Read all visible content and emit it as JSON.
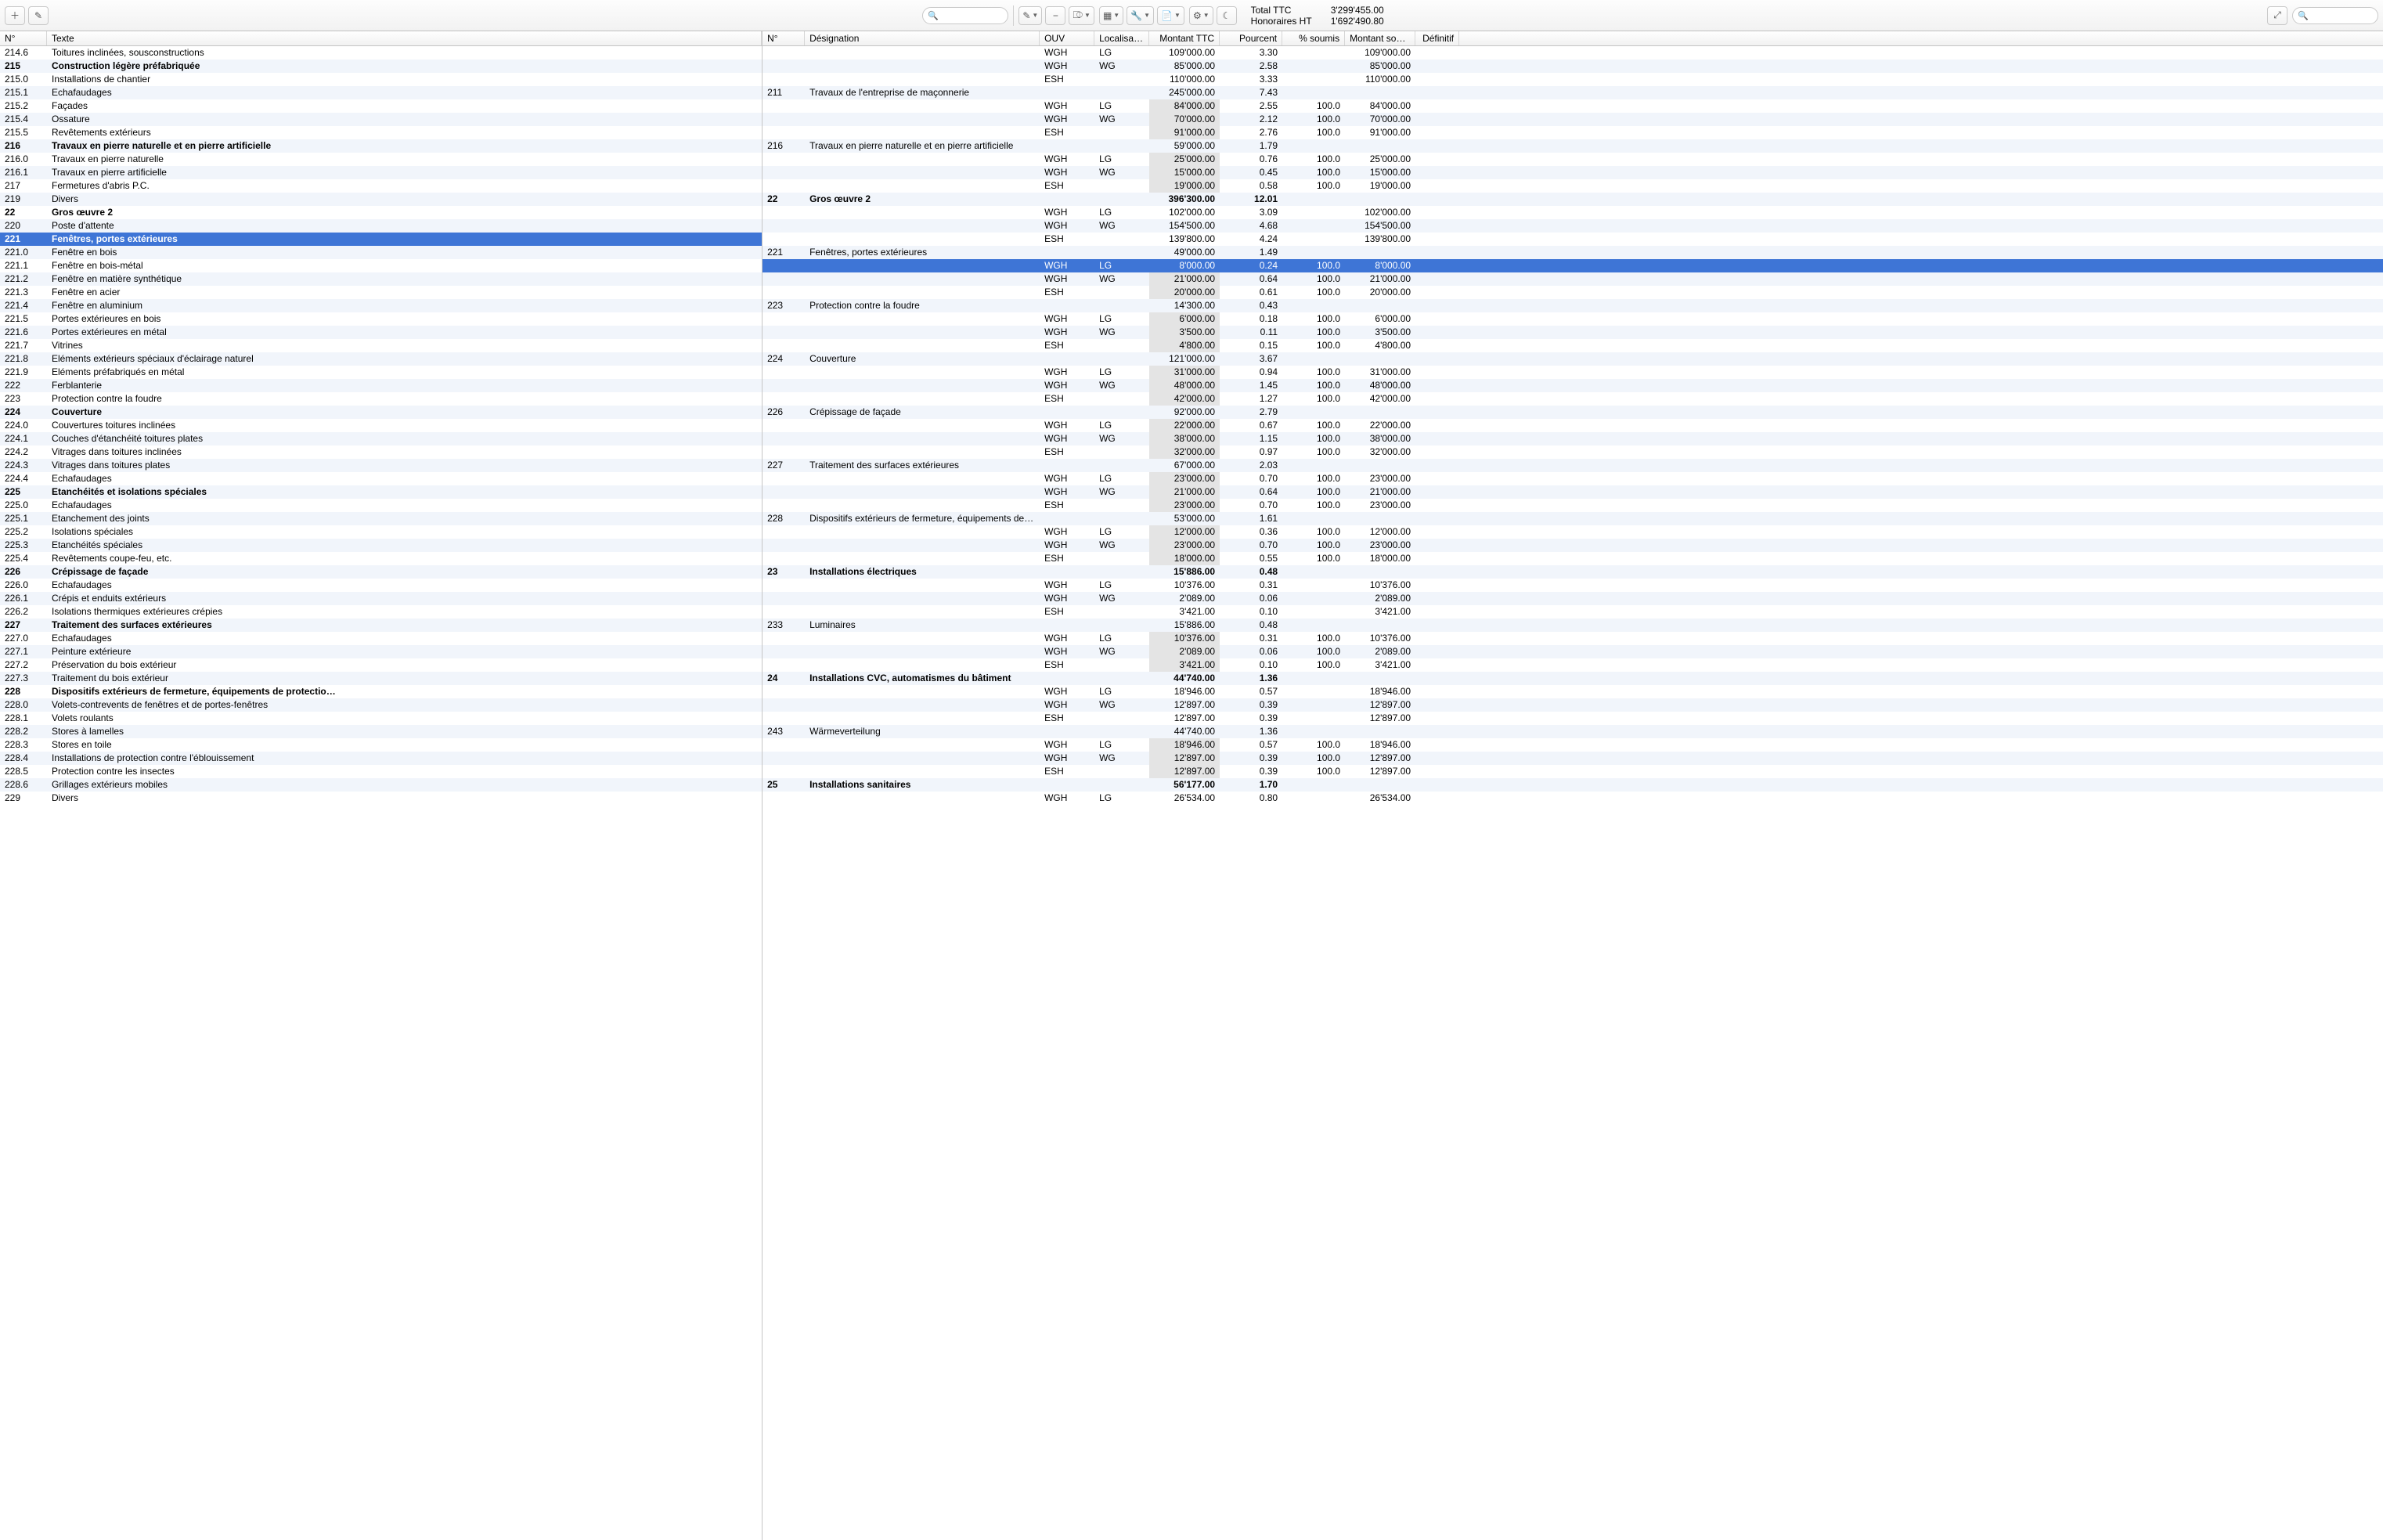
{
  "toolbar": {
    "add_icon": "＋",
    "edit_icon": "✎",
    "search_placeholder": "",
    "pencil_dd": "✎",
    "minus": "−",
    "filter": "⎄",
    "table": "▦",
    "wrench": "🔧",
    "doc": "📄",
    "gear": "⚙",
    "moon": "☾",
    "expand": "⤢"
  },
  "summary": {
    "total_label": "Total TTC",
    "total_value": "3'299'455.00",
    "fees_label": "Honoraires HT",
    "fees_value": "1'692'490.80"
  },
  "left": {
    "headers": {
      "no": "N°",
      "text": "Texte"
    },
    "selected_no": "221",
    "rows": [
      {
        "no": "214.6",
        "text": "Toitures inclinées, sousconstructions"
      },
      {
        "no": "215",
        "text": "Construction légère préfabriquée",
        "bold": true
      },
      {
        "no": "215.0",
        "text": "Installations de chantier"
      },
      {
        "no": "215.1",
        "text": "Echafaudages"
      },
      {
        "no": "215.2",
        "text": "Façades"
      },
      {
        "no": "215.4",
        "text": "Ossature"
      },
      {
        "no": "215.5",
        "text": "Revêtements extérieurs"
      },
      {
        "no": "216",
        "text": "Travaux en pierre naturelle et en pierre artificielle",
        "bold": true
      },
      {
        "no": "216.0",
        "text": "Travaux en pierre naturelle"
      },
      {
        "no": "216.1",
        "text": "Travaux en pierre artificielle"
      },
      {
        "no": "217",
        "text": "Fermetures d'abris P.C."
      },
      {
        "no": "219",
        "text": "Divers"
      },
      {
        "no": "22",
        "text": "Gros œuvre 2",
        "bold": true
      },
      {
        "no": "220",
        "text": "Poste d'attente"
      },
      {
        "no": "221",
        "text": "Fenêtres, portes extérieures",
        "bold": true
      },
      {
        "no": "221.0",
        "text": "Fenêtre en bois"
      },
      {
        "no": "221.1",
        "text": "Fenêtre en bois-métal"
      },
      {
        "no": "221.2",
        "text": "Fenêtre en matière synthétique"
      },
      {
        "no": "221.3",
        "text": "Fenêtre en acier"
      },
      {
        "no": "221.4",
        "text": "Fenêtre en aluminium"
      },
      {
        "no": "221.5",
        "text": "Portes extérieures en bois"
      },
      {
        "no": "221.6",
        "text": "Portes extérieures en métal"
      },
      {
        "no": "221.7",
        "text": "Vitrines"
      },
      {
        "no": "221.8",
        "text": "Eléments extérieurs spéciaux d'éclairage naturel"
      },
      {
        "no": "221.9",
        "text": "Eléments préfabriqués en métal"
      },
      {
        "no": "222",
        "text": "Ferblanterie"
      },
      {
        "no": "223",
        "text": "Protection contre la foudre"
      },
      {
        "no": "224",
        "text": "Couverture",
        "bold": true
      },
      {
        "no": "224.0",
        "text": "Couvertures toitures inclinées"
      },
      {
        "no": "224.1",
        "text": "Couches d'étanchéité toitures plates"
      },
      {
        "no": "224.2",
        "text": "Vitrages dans toitures inclinées"
      },
      {
        "no": "224.3",
        "text": "Vitrages dans toitures plates"
      },
      {
        "no": "224.4",
        "text": "Echafaudages"
      },
      {
        "no": "225",
        "text": "Etanchéités et isolations spéciales",
        "bold": true
      },
      {
        "no": "225.0",
        "text": "Echafaudages"
      },
      {
        "no": "225.1",
        "text": "Etanchement des joints"
      },
      {
        "no": "225.2",
        "text": "Isolations spéciales"
      },
      {
        "no": "225.3",
        "text": "Etanchéités spéciales"
      },
      {
        "no": "225.4",
        "text": "Revêtements coupe-feu, etc."
      },
      {
        "no": "226",
        "text": "Crépissage de façade",
        "bold": true
      },
      {
        "no": "226.0",
        "text": "Echafaudages"
      },
      {
        "no": "226.1",
        "text": "Crépis et enduits extérieurs"
      },
      {
        "no": "226.2",
        "text": "Isolations thermiques extérieures crépies"
      },
      {
        "no": "227",
        "text": "Traitement des surfaces extérieures",
        "bold": true
      },
      {
        "no": "227.0",
        "text": "Echafaudages"
      },
      {
        "no": "227.1",
        "text": "Peinture extérieure"
      },
      {
        "no": "227.2",
        "text": "Préservation du bois extérieur"
      },
      {
        "no": "227.3",
        "text": "Traitement du bois extérieur"
      },
      {
        "no": "228",
        "text": "Dispositifs extérieurs de fermeture, équipements de protectio…",
        "bold": true
      },
      {
        "no": "228.0",
        "text": "Volets-contrevents de fenêtres et de portes-fenêtres"
      },
      {
        "no": "228.1",
        "text": "Volets roulants"
      },
      {
        "no": "228.2",
        "text": "Stores à lamelles"
      },
      {
        "no": "228.3",
        "text": "Stores en toile"
      },
      {
        "no": "228.4",
        "text": "Installations de protection contre l'éblouissement"
      },
      {
        "no": "228.5",
        "text": "Protection contre les insectes"
      },
      {
        "no": "228.6",
        "text": "Grillages extérieurs mobiles"
      },
      {
        "no": "229",
        "text": "Divers"
      }
    ]
  },
  "right": {
    "headers": {
      "no": "N°",
      "desig": "Désignation",
      "ouv": "OUV",
      "loc": "Localisation",
      "ttc": "Montant TTC",
      "pct": "Pourcent",
      "sou": "% soumis",
      "msou": "Montant sou…",
      "def": "Définitif"
    },
    "selected_index": 15,
    "rows": [
      {
        "no": "",
        "desig": "",
        "ouv": "WGH",
        "loc": "LG",
        "ttc": "109'000.00",
        "pct": "3.30",
        "sou": "",
        "msou": "109'000.00",
        "def": ""
      },
      {
        "no": "",
        "desig": "",
        "ouv": "WGH",
        "loc": "WG",
        "ttc": "85'000.00",
        "pct": "2.58",
        "sou": "",
        "msou": "85'000.00",
        "def": ""
      },
      {
        "no": "",
        "desig": "",
        "ouv": "ESH",
        "loc": "",
        "ttc": "110'000.00",
        "pct": "3.33",
        "sou": "",
        "msou": "110'000.00",
        "def": ""
      },
      {
        "no": "211",
        "desig": "Travaux de l'entreprise de maçonnerie",
        "ttc": "245'000.00",
        "pct": "7.43"
      },
      {
        "no": "",
        "desig": "",
        "ouv": "WGH",
        "loc": "LG",
        "ttc": "84'000.00",
        "pct": "2.55",
        "sou": "100.0",
        "msou": "84'000.00",
        "shade": true
      },
      {
        "no": "",
        "desig": "",
        "ouv": "WGH",
        "loc": "WG",
        "ttc": "70'000.00",
        "pct": "2.12",
        "sou": "100.0",
        "msou": "70'000.00",
        "shade": true
      },
      {
        "no": "",
        "desig": "",
        "ouv": "ESH",
        "loc": "",
        "ttc": "91'000.00",
        "pct": "2.76",
        "sou": "100.0",
        "msou": "91'000.00",
        "shade": true
      },
      {
        "no": "216",
        "desig": "Travaux en pierre naturelle et en pierre artificielle",
        "ttc": "59'000.00",
        "pct": "1.79"
      },
      {
        "no": "",
        "desig": "",
        "ouv": "WGH",
        "loc": "LG",
        "ttc": "25'000.00",
        "pct": "0.76",
        "sou": "100.0",
        "msou": "25'000.00",
        "shade": true
      },
      {
        "no": "",
        "desig": "",
        "ouv": "WGH",
        "loc": "WG",
        "ttc": "15'000.00",
        "pct": "0.45",
        "sou": "100.0",
        "msou": "15'000.00",
        "shade": true
      },
      {
        "no": "",
        "desig": "",
        "ouv": "ESH",
        "loc": "",
        "ttc": "19'000.00",
        "pct": "0.58",
        "sou": "100.0",
        "msou": "19'000.00",
        "shade": true
      },
      {
        "no": "22",
        "desig": "Gros œuvre 2",
        "ttc": "396'300.00",
        "pct": "12.01",
        "bold": true
      },
      {
        "no": "",
        "desig": "",
        "ouv": "WGH",
        "loc": "LG",
        "ttc": "102'000.00",
        "pct": "3.09",
        "sou": "",
        "msou": "102'000.00"
      },
      {
        "no": "",
        "desig": "",
        "ouv": "WGH",
        "loc": "WG",
        "ttc": "154'500.00",
        "pct": "4.68",
        "sou": "",
        "msou": "154'500.00"
      },
      {
        "no": "",
        "desig": "",
        "ouv": "ESH",
        "loc": "",
        "ttc": "139'800.00",
        "pct": "4.24",
        "sou": "",
        "msou": "139'800.00"
      },
      {
        "no": "221",
        "desig": "Fenêtres, portes extérieures",
        "ttc": "49'000.00",
        "pct": "1.49"
      },
      {
        "no": "",
        "desig": "",
        "ouv": "WGH",
        "loc": "LG",
        "ttc": "8'000.00",
        "pct": "0.24",
        "sou": "100.0",
        "msou": "8'000.00",
        "shade": true,
        "selected": true
      },
      {
        "no": "",
        "desig": "",
        "ouv": "WGH",
        "loc": "WG",
        "ttc": "21'000.00",
        "pct": "0.64",
        "sou": "100.0",
        "msou": "21'000.00",
        "shade": true
      },
      {
        "no": "",
        "desig": "",
        "ouv": "ESH",
        "loc": "",
        "ttc": "20'000.00",
        "pct": "0.61",
        "sou": "100.0",
        "msou": "20'000.00",
        "shade": true
      },
      {
        "no": "223",
        "desig": "Protection contre la foudre",
        "ttc": "14'300.00",
        "pct": "0.43"
      },
      {
        "no": "",
        "desig": "",
        "ouv": "WGH",
        "loc": "LG",
        "ttc": "6'000.00",
        "pct": "0.18",
        "sou": "100.0",
        "msou": "6'000.00",
        "shade": true
      },
      {
        "no": "",
        "desig": "",
        "ouv": "WGH",
        "loc": "WG",
        "ttc": "3'500.00",
        "pct": "0.11",
        "sou": "100.0",
        "msou": "3'500.00",
        "shade": true
      },
      {
        "no": "",
        "desig": "",
        "ouv": "ESH",
        "loc": "",
        "ttc": "4'800.00",
        "pct": "0.15",
        "sou": "100.0",
        "msou": "4'800.00",
        "shade": true
      },
      {
        "no": "224",
        "desig": "Couverture",
        "ttc": "121'000.00",
        "pct": "3.67"
      },
      {
        "no": "",
        "desig": "",
        "ouv": "WGH",
        "loc": "LG",
        "ttc": "31'000.00",
        "pct": "0.94",
        "sou": "100.0",
        "msou": "31'000.00",
        "shade": true
      },
      {
        "no": "",
        "desig": "",
        "ouv": "WGH",
        "loc": "WG",
        "ttc": "48'000.00",
        "pct": "1.45",
        "sou": "100.0",
        "msou": "48'000.00",
        "shade": true
      },
      {
        "no": "",
        "desig": "",
        "ouv": "ESH",
        "loc": "",
        "ttc": "42'000.00",
        "pct": "1.27",
        "sou": "100.0",
        "msou": "42'000.00",
        "shade": true
      },
      {
        "no": "226",
        "desig": "Crépissage de façade",
        "ttc": "92'000.00",
        "pct": "2.79"
      },
      {
        "no": "",
        "desig": "",
        "ouv": "WGH",
        "loc": "LG",
        "ttc": "22'000.00",
        "pct": "0.67",
        "sou": "100.0",
        "msou": "22'000.00",
        "shade": true
      },
      {
        "no": "",
        "desig": "",
        "ouv": "WGH",
        "loc": "WG",
        "ttc": "38'000.00",
        "pct": "1.15",
        "sou": "100.0",
        "msou": "38'000.00",
        "shade": true
      },
      {
        "no": "",
        "desig": "",
        "ouv": "ESH",
        "loc": "",
        "ttc": "32'000.00",
        "pct": "0.97",
        "sou": "100.0",
        "msou": "32'000.00",
        "shade": true
      },
      {
        "no": "227",
        "desig": "Traitement des surfaces extérieures",
        "ttc": "67'000.00",
        "pct": "2.03"
      },
      {
        "no": "",
        "desig": "",
        "ouv": "WGH",
        "loc": "LG",
        "ttc": "23'000.00",
        "pct": "0.70",
        "sou": "100.0",
        "msou": "23'000.00",
        "shade": true
      },
      {
        "no": "",
        "desig": "",
        "ouv": "WGH",
        "loc": "WG",
        "ttc": "21'000.00",
        "pct": "0.64",
        "sou": "100.0",
        "msou": "21'000.00",
        "shade": true
      },
      {
        "no": "",
        "desig": "",
        "ouv": "ESH",
        "loc": "",
        "ttc": "23'000.00",
        "pct": "0.70",
        "sou": "100.0",
        "msou": "23'000.00",
        "shade": true
      },
      {
        "no": "228",
        "desig": "Dispositifs extérieurs de fermeture, équipements de prot…",
        "ttc": "53'000.00",
        "pct": "1.61"
      },
      {
        "no": "",
        "desig": "",
        "ouv": "WGH",
        "loc": "LG",
        "ttc": "12'000.00",
        "pct": "0.36",
        "sou": "100.0",
        "msou": "12'000.00",
        "shade": true
      },
      {
        "no": "",
        "desig": "",
        "ouv": "WGH",
        "loc": "WG",
        "ttc": "23'000.00",
        "pct": "0.70",
        "sou": "100.0",
        "msou": "23'000.00",
        "shade": true
      },
      {
        "no": "",
        "desig": "",
        "ouv": "ESH",
        "loc": "",
        "ttc": "18'000.00",
        "pct": "0.55",
        "sou": "100.0",
        "msou": "18'000.00",
        "shade": true
      },
      {
        "no": "23",
        "desig": "Installations électriques",
        "ttc": "15'886.00",
        "pct": "0.48",
        "bold": true
      },
      {
        "no": "",
        "desig": "",
        "ouv": "WGH",
        "loc": "LG",
        "ttc": "10'376.00",
        "pct": "0.31",
        "sou": "",
        "msou": "10'376.00"
      },
      {
        "no": "",
        "desig": "",
        "ouv": "WGH",
        "loc": "WG",
        "ttc": "2'089.00",
        "pct": "0.06",
        "sou": "",
        "msou": "2'089.00"
      },
      {
        "no": "",
        "desig": "",
        "ouv": "ESH",
        "loc": "",
        "ttc": "3'421.00",
        "pct": "0.10",
        "sou": "",
        "msou": "3'421.00"
      },
      {
        "no": "233",
        "desig": "Luminaires",
        "ttc": "15'886.00",
        "pct": "0.48"
      },
      {
        "no": "",
        "desig": "",
        "ouv": "WGH",
        "loc": "LG",
        "ttc": "10'376.00",
        "pct": "0.31",
        "sou": "100.0",
        "msou": "10'376.00",
        "shade": true
      },
      {
        "no": "",
        "desig": "",
        "ouv": "WGH",
        "loc": "WG",
        "ttc": "2'089.00",
        "pct": "0.06",
        "sou": "100.0",
        "msou": "2'089.00",
        "shade": true
      },
      {
        "no": "",
        "desig": "",
        "ouv": "ESH",
        "loc": "",
        "ttc": "3'421.00",
        "pct": "0.10",
        "sou": "100.0",
        "msou": "3'421.00",
        "shade": true
      },
      {
        "no": "24",
        "desig": "Installations CVC, automatismes du bâtiment",
        "ttc": "44'740.00",
        "pct": "1.36",
        "bold": true
      },
      {
        "no": "",
        "desig": "",
        "ouv": "WGH",
        "loc": "LG",
        "ttc": "18'946.00",
        "pct": "0.57",
        "sou": "",
        "msou": "18'946.00"
      },
      {
        "no": "",
        "desig": "",
        "ouv": "WGH",
        "loc": "WG",
        "ttc": "12'897.00",
        "pct": "0.39",
        "sou": "",
        "msou": "12'897.00"
      },
      {
        "no": "",
        "desig": "",
        "ouv": "ESH",
        "loc": "",
        "ttc": "12'897.00",
        "pct": "0.39",
        "sou": "",
        "msou": "12'897.00"
      },
      {
        "no": "243",
        "desig": "Wärmeverteilung",
        "ttc": "44'740.00",
        "pct": "1.36"
      },
      {
        "no": "",
        "desig": "",
        "ouv": "WGH",
        "loc": "LG",
        "ttc": "18'946.00",
        "pct": "0.57",
        "sou": "100.0",
        "msou": "18'946.00",
        "shade": true
      },
      {
        "no": "",
        "desig": "",
        "ouv": "WGH",
        "loc": "WG",
        "ttc": "12'897.00",
        "pct": "0.39",
        "sou": "100.0",
        "msou": "12'897.00",
        "shade": true
      },
      {
        "no": "",
        "desig": "",
        "ouv": "ESH",
        "loc": "",
        "ttc": "12'897.00",
        "pct": "0.39",
        "sou": "100.0",
        "msou": "12'897.00",
        "shade": true
      },
      {
        "no": "25",
        "desig": "Installations sanitaires",
        "ttc": "56'177.00",
        "pct": "1.70",
        "bold": true
      },
      {
        "no": "",
        "desig": "",
        "ouv": "WGH",
        "loc": "LG",
        "ttc": "26'534.00",
        "pct": "0.80",
        "sou": "",
        "msou": "26'534.00"
      }
    ]
  }
}
